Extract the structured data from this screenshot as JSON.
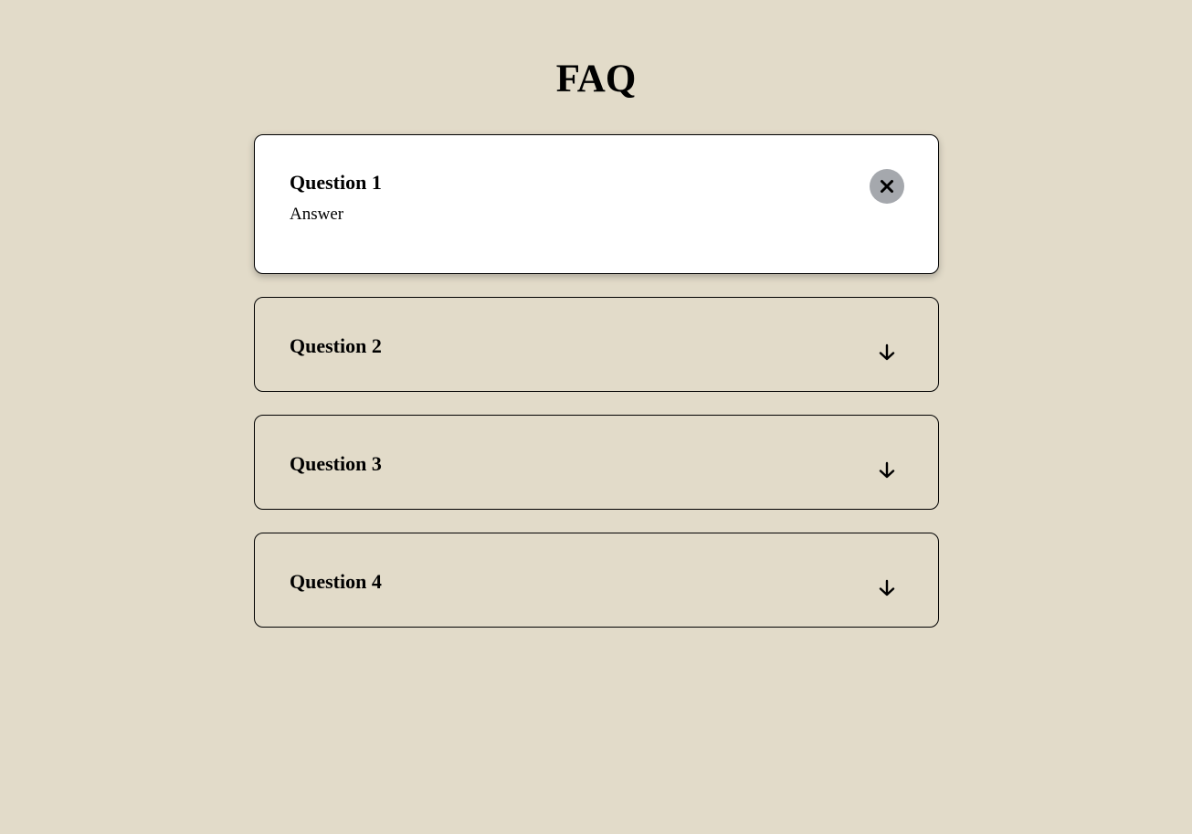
{
  "page": {
    "title": "FAQ",
    "background": "#e2dbc9"
  },
  "faq": {
    "items": [
      {
        "question": "Question 1",
        "answer": "Answer",
        "expanded": true,
        "toggle_icon": "close-icon"
      },
      {
        "question": "Question 2",
        "expanded": false,
        "toggle_icon": "arrow-down-icon"
      },
      {
        "question": "Question 3",
        "expanded": false,
        "toggle_icon": "arrow-down-icon"
      },
      {
        "question": "Question 4",
        "expanded": false,
        "toggle_icon": "arrow-down-icon"
      }
    ],
    "open_card_color": "#ffffff",
    "close_button_color": "#a5a8ad"
  }
}
